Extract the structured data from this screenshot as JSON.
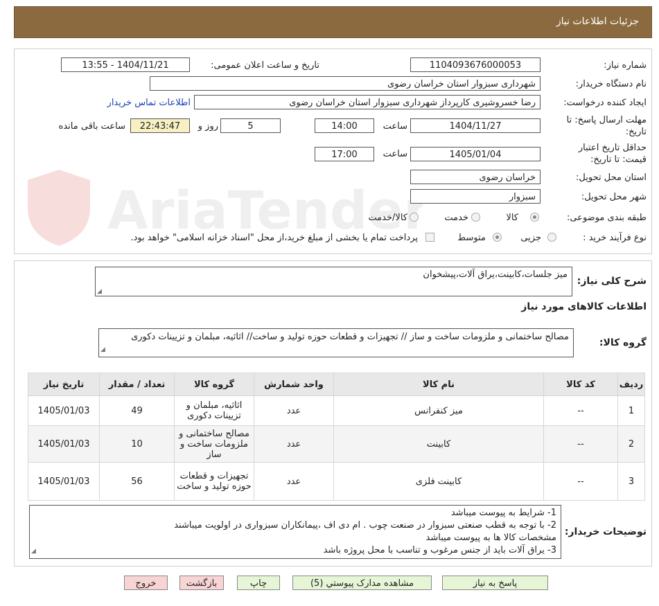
{
  "header": {
    "title": "جزئیات اطلاعات نیاز"
  },
  "form": {
    "need_number_label": "شماره نیاز:",
    "need_number": "1104093676000053",
    "announce_label": "تاریخ و ساعت اعلان عمومی:",
    "announce_value": "1404/11/21 - 13:55",
    "buyer_org_label": "نام دستگاه خریدار:",
    "buyer_org": "شهرداری سبزوار استان خراسان رضوی",
    "creator_label": "ایجاد کننده درخواست:",
    "creator": "رضا خسروشیری کارپرداز شهرداری سبزوار استان خراسان رضوی",
    "contact_link": "اطلاعات تماس خریدار",
    "deadline_label_1": "مهلت ارسال پاسخ: تا",
    "deadline_label_2": "تاریخ:",
    "deadline_date": "1404/11/27",
    "time_word": "ساعت",
    "deadline_time": "14:00",
    "days_value": "5",
    "days_word": "روز و",
    "remaining_time": "22:43:47",
    "remaining_word": "ساعت باقی مانده",
    "validity_label_1": "حداقل تاریخ اعتبار",
    "validity_label_2": "قیمت: تا تاریخ:",
    "validity_date": "1405/01/04",
    "validity_time": "17:00",
    "province_label": "استان محل تحویل:",
    "province": "خراسان رضوی",
    "city_label": "شهر محل تحویل:",
    "city": "سبزوار",
    "category_label": "طبقه بندی موضوعی:",
    "category_options": [
      "کالا",
      "خدمت",
      "کالا/خدمت"
    ],
    "process_label": "نوع فرآیند خرید :",
    "process_options": [
      "جزیی",
      "متوسط"
    ],
    "payment_note": "پرداخت تمام یا بخشی از مبلغ خرید،از محل \"اسناد خزانه اسلامی\" خواهد بود."
  },
  "need": {
    "summary_label": "شرح کلی نیاز:",
    "summary": "میز جلسات،کابینت،یراق آلات،پیشخوان",
    "items_title": "اطلاعات کالاهای مورد نیاز",
    "group_label": "گروه کالا:",
    "group_value": "مصالح ساختمانی و ملزومات ساخت و ساز // تجهیزات و قطعات حوزه تولید و ساخت// اثاثیه، مبلمان و تزیینات دکوری"
  },
  "table": {
    "headers": [
      "ردیف",
      "کد کالا",
      "نام کالا",
      "واحد شمارش",
      "گروه کالا",
      "تعداد / مقدار",
      "تاریخ نیاز"
    ],
    "rows": [
      [
        "1",
        "--",
        "میز کنفرانس",
        "عدد",
        "اثاثیه، مبلمان و تزیینات دکوری",
        "49",
        "1405/01/03"
      ],
      [
        "2",
        "--",
        "کابینت",
        "عدد",
        "مصالح ساختمانی و ملزومات ساخت و ساز",
        "10",
        "1405/01/03"
      ],
      [
        "3",
        "--",
        "کابینت فلزی",
        "عدد",
        "تجهیزات و قطعات حوزه تولید و ساخت",
        "56",
        "1405/01/03"
      ]
    ]
  },
  "notes": {
    "label": "توضیحات خریدار:",
    "lines": [
      "1- شرایط به پیوست میباشد",
      "2- با توجه به قطب صنعتی سبزوار در صنعت چوب . ام دی اف ،پیمانکاران سبزواری در اولویت میباشند",
      "مشخصات کالا ها به پیوست میباشد",
      "3- یراق آلات باید از جنس مرغوب و تناسب با محل پروژه باشد"
    ]
  },
  "buttons": {
    "reply": "پاسخ به نیاز",
    "attachments": "مشاهده مدارک پیوستي (5)",
    "print": "چاپ",
    "back": "بازگشت",
    "exit": "خروج"
  },
  "watermark": {
    "text": "AriaTender.neT"
  }
}
